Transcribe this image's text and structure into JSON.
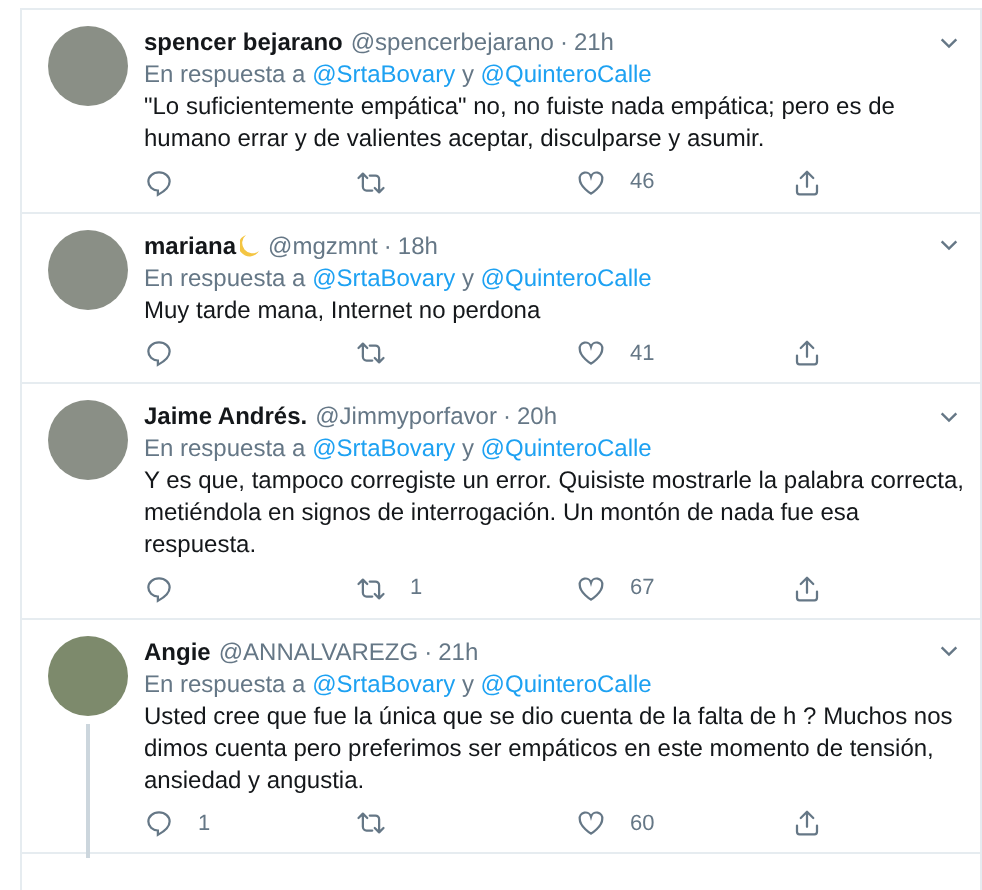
{
  "tweets": [
    {
      "kind": "plain",
      "name": "spencer bejarano",
      "handle": "@spencerbejarano",
      "separator": "·",
      "time": "21h",
      "reply_prefix": "En respuesta a",
      "mentions": [
        "@SrtaBovary",
        "@QuinteroCalle"
      ],
      "mention_joiner": "y",
      "text": "\"Lo suficientemente empática\" no, no fuiste nada empática; pero es de humano errar y de valientes aceptar, disculparse y asumir.",
      "likes": "46",
      "thread": false
    },
    {
      "kind": "moon",
      "name": "mariana",
      "handle": "@mgzmnt",
      "separator": "·",
      "time": "18h",
      "reply_prefix": "En respuesta a",
      "mentions": [
        "@SrtaBovary",
        "@QuinteroCalle"
      ],
      "mention_joiner": "y",
      "text": "Muy tarde mana, Internet no perdona",
      "likes": "41",
      "thread": false
    },
    {
      "kind": "plain",
      "name": "Jaime Andrés.",
      "handle": "@Jimmyporfavor",
      "separator": "·",
      "time": "20h",
      "reply_prefix": "En respuesta a",
      "mentions": [
        "@SrtaBovary",
        "@QuinteroCalle"
      ],
      "mention_joiner": "y",
      "text": "Y es que, tampoco corregiste un error. Quisiste mostrarle la palabra correcta, metiéndola en signos de interrogación. Un montón de nada fue esa respuesta.",
      "retweets": "1",
      "likes": "67",
      "thread": false
    },
    {
      "kind": "plain",
      "name": "Angie",
      "handle": "@ANNALVAREZG",
      "separator": "·",
      "time": "21h",
      "reply_prefix": "En respuesta a",
      "mentions": [
        "@SrtaBovary",
        "@QuinteroCalle"
      ],
      "mention_joiner": "y",
      "text": "Usted cree que fue la única que se dio cuenta de la falta de h ? Muchos nos dimos cuenta pero preferimos ser empáticos en este momento de tensión, ansiedad y angustia.",
      "replies": "1",
      "likes": "60",
      "thread": true
    }
  ]
}
